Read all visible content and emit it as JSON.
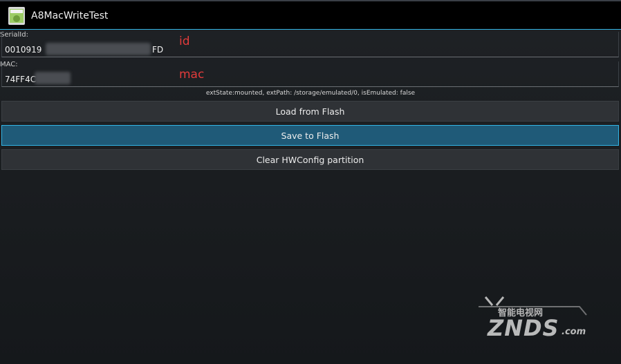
{
  "app": {
    "title": "A8MacWriteTest"
  },
  "serial": {
    "label": "SerialId:",
    "value_prefix": "0010919",
    "value_suffix": "FD",
    "annotation": "id"
  },
  "mac": {
    "label": "MAC:",
    "value_prefix": "74FF4C",
    "annotation": "mac"
  },
  "status": {
    "text": "extState:mounted, extPath: /storage/emulated/0, isEmulated: false"
  },
  "buttons": {
    "load": "Load from Flash",
    "save": "Save to Flash",
    "clear": "Clear HWConfig partition"
  },
  "watermark": {
    "top": "智能电视网",
    "main": "ZNDS",
    "suffix": ".com"
  },
  "colors": {
    "accent": "#33b5e5",
    "annotation": "#e23b3b"
  }
}
